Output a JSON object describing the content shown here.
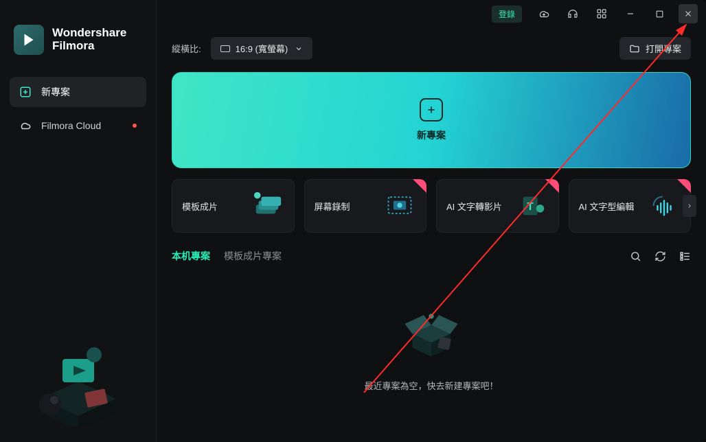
{
  "brand": {
    "line1": "Wondershare",
    "line2": "Filmora"
  },
  "sidebar": {
    "items": [
      {
        "label": "新專案",
        "icon": "plus-square-icon"
      },
      {
        "label": "Filmora Cloud",
        "icon": "cloud-icon"
      }
    ]
  },
  "titlebar": {
    "login": "登錄"
  },
  "controls": {
    "aspect_label": "縱橫比:",
    "aspect_value": "16:9 (寬螢幕)",
    "open_project": "打開專案"
  },
  "hero": {
    "label": "新專案"
  },
  "cards": [
    {
      "label": "模板成片",
      "new": false
    },
    {
      "label": "屏幕錄制",
      "new": true
    },
    {
      "label": "AI 文字轉影片",
      "new": true
    },
    {
      "label": "AI 文字型編輯",
      "new": true
    }
  ],
  "tabs": {
    "local": "本机專案",
    "template": "模板成片專案"
  },
  "empty": {
    "message": "最近專案為空，快去新建專案吧！"
  }
}
